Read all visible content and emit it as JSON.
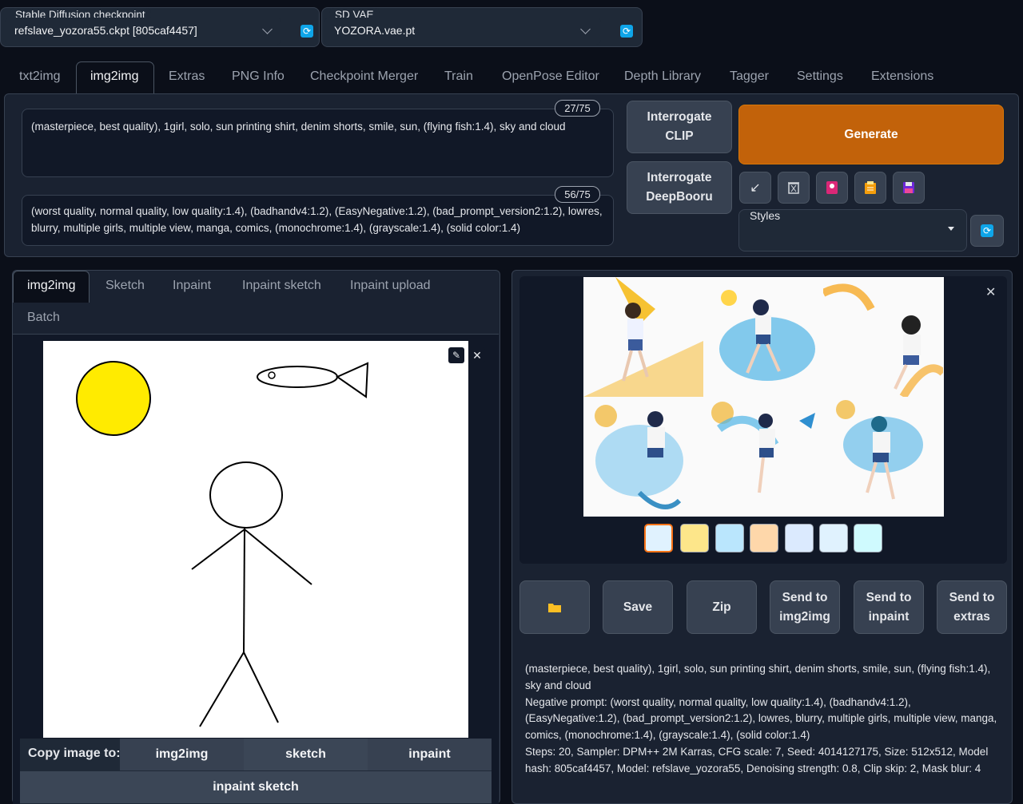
{
  "checkpoint": {
    "label": "Stable Diffusion checkpoint",
    "value": "refslave_yozora55.ckpt [805caf4457]",
    "refresh_icon": "refresh-icon"
  },
  "vae": {
    "label": "SD VAE",
    "value": "YOZORA.vae.pt",
    "refresh_icon": "refresh-icon"
  },
  "tabs": [
    "txt2img",
    "img2img",
    "Extras",
    "PNG Info",
    "Checkpoint Merger",
    "Train",
    "OpenPose Editor",
    "Depth Library",
    "Tagger",
    "Settings",
    "Extensions"
  ],
  "prompt": {
    "text": "(masterpiece, best quality), 1girl, solo, sun printing shirt, denim shorts, smile, sun, (flying fish:1.4), sky and cloud",
    "counter": "27/75"
  },
  "negative_prompt": {
    "text": "(worst quality, normal quality, low quality:1.4), (badhandv4:1.2), (EasyNegative:1.2), (bad_prompt_version2:1.2), lowres, blurry, multiple girls, multiple view, manga, comics, (monochrome:1.4), (grayscale:1.4), (solid color:1.4)",
    "counter": "56/75"
  },
  "interrogate_clip": {
    "line1": "Interrogate",
    "line2": "CLIP"
  },
  "interrogate_deepbooru": {
    "line1": "Interrogate",
    "line2": "DeepBooru"
  },
  "generate_label": "Generate",
  "tool_icons": [
    "arrow-icon",
    "trash-icon",
    "red-card-icon",
    "clipboard-icon",
    "floppy-disk-icon"
  ],
  "styles_label": "Styles",
  "subtabs": [
    "img2img",
    "Sketch",
    "Inpaint",
    "Inpaint sketch",
    "Inpaint upload",
    "Batch"
  ],
  "copy": {
    "label": "Copy image to:",
    "img2img": "img2img",
    "sketch": "sketch",
    "inpaint": "inpaint",
    "inpaint_sketch": "inpaint sketch"
  },
  "output_buttons": {
    "folder_icon": "folder-icon",
    "save": "Save",
    "zip": "Zip",
    "send_img2img": {
      "line1": "Send to",
      "line2": "img2img"
    },
    "send_inpaint": {
      "line1": "Send to",
      "line2": "inpaint"
    },
    "send_extras": {
      "line1": "Send to",
      "line2": "extras"
    }
  },
  "generation_info": {
    "prompt_line": "(masterpiece, best quality), 1girl, solo, sun printing shirt, denim shorts, smile, sun, (flying fish:1.4), sky and cloud",
    "negative_line": "Negative prompt: (worst quality, normal quality, low quality:1.4), (badhandv4:1.2), (EasyNegative:1.2), (bad_prompt_version2:1.2), lowres, blurry, multiple girls, multiple view, manga, comics, (monochrome:1.4), (grayscale:1.4), (solid color:1.4)",
    "params_line": "Steps: 20, Sampler: DPM++ 2M Karras, CFG scale: 7, Seed: 4014127175, Size: 512x512, Model hash: 805caf4457, Model: refslave_yozora55, Denoising strength: 0.8, Clip skip: 2, Mask blur: 4"
  },
  "colors": {
    "accent": "#c2620a",
    "background": "#0b0f19",
    "panel": "#111827",
    "button": "#374151",
    "selected_thumb": "#f97316"
  }
}
